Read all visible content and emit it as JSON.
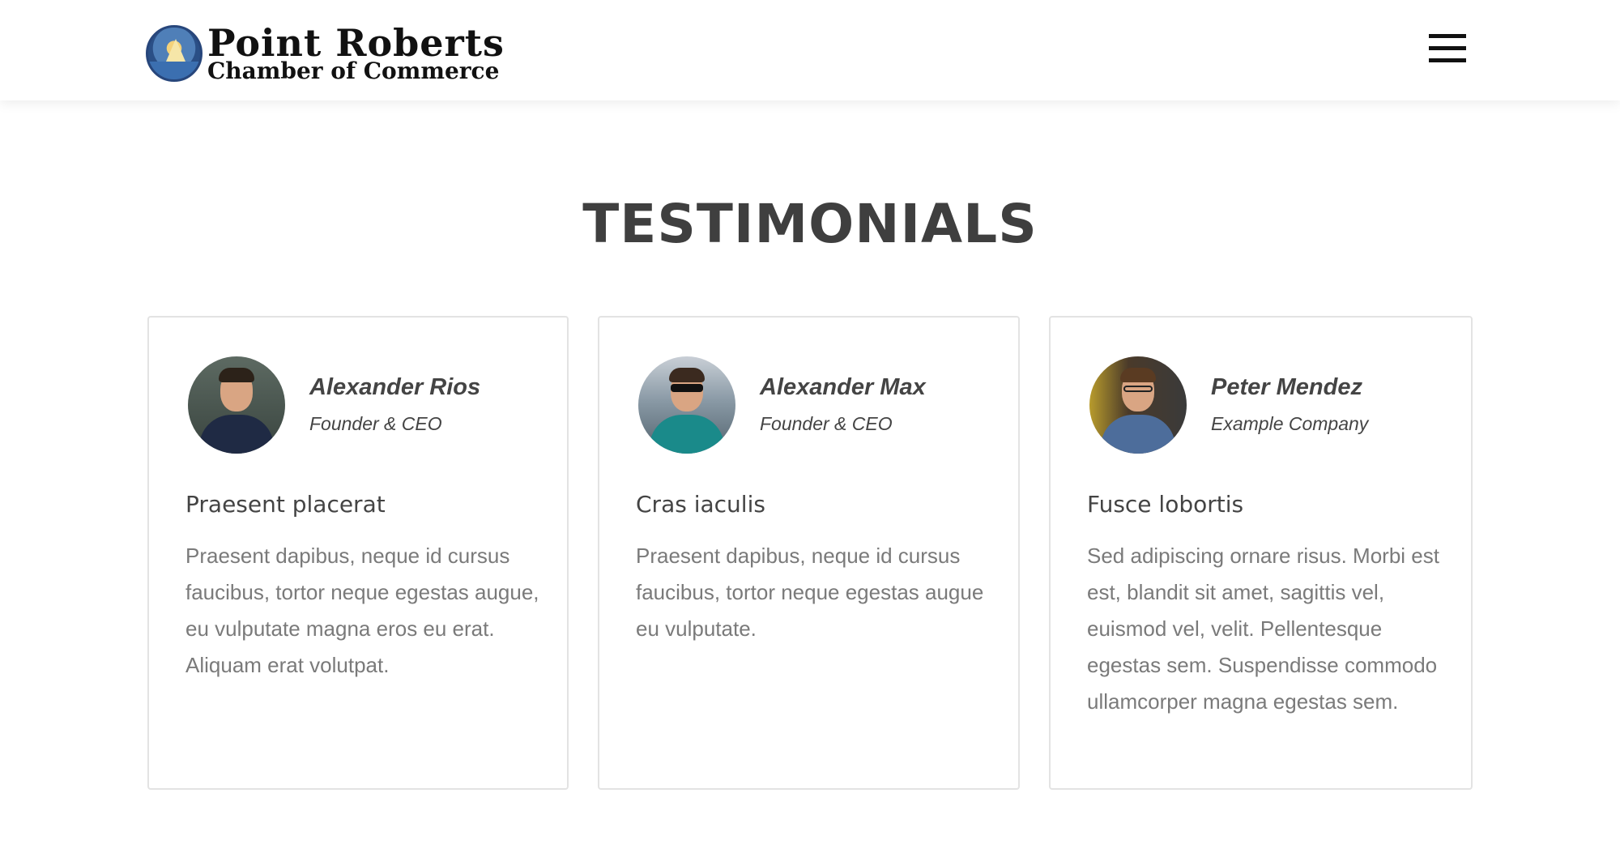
{
  "header": {
    "logo_title": "Point Roberts",
    "logo_subtitle": "Chamber of Commerce",
    "menu_icon": "hamburger-menu-icon"
  },
  "section": {
    "title": "TESTIMONIALS"
  },
  "testimonials": [
    {
      "name": "Alexander Rios",
      "role": "Founder & CEO",
      "heading": "Praesent placerat",
      "text": "Praesent dapibus, neque id cursus faucibus, tortor neque egestas augue, eu vulputate magna eros eu erat. Aliquam erat volutpat."
    },
    {
      "name": "Alexander Max",
      "role": "Founder & CEO",
      "heading": "Cras iaculis",
      "text": "Praesent dapibus, neque id cursus faucibus, tortor neque egestas augue eu vulputate."
    },
    {
      "name": "Peter Mendez",
      "role": "Example Company",
      "heading": "Fusce lobortis",
      "text": "Sed adipiscing ornare risus. Morbi est est, blandit sit amet, sagittis vel, euismod vel, velit. Pellentesque egestas sem. Suspendisse commodo ullamcorper magna egestas sem."
    }
  ],
  "colors": {
    "title": "#3f3f3f",
    "body_text": "#7a7a7a",
    "card_border": "#e3e3e3"
  }
}
